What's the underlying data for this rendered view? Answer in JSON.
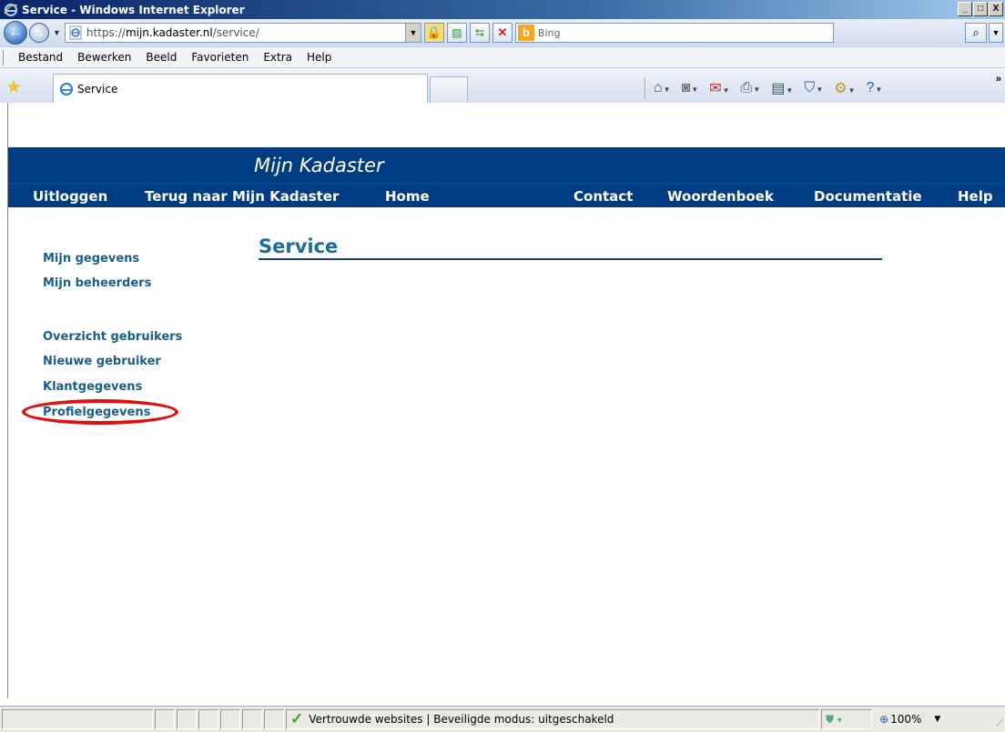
{
  "window": {
    "title": "Service - Windows Internet Explorer",
    "minimize": "_",
    "maximize": "□",
    "close": "X"
  },
  "address_bar": {
    "url_proto": "https://",
    "url_host": "mijn.kadaster.nl",
    "url_path": "/service/"
  },
  "search": {
    "placeholder": "Bing",
    "go": "⌕"
  },
  "menu": {
    "items": [
      "Bestand",
      "Bewerken",
      "Beeld",
      "Favorieten",
      "Extra",
      "Help"
    ]
  },
  "tab": {
    "label": "Service"
  },
  "site": {
    "brand": "Mijn Kadaster",
    "nav": {
      "logout": "Uitloggen",
      "back": "Terug naar Mijn Kadaster",
      "home": "Home",
      "contact": "Contact",
      "dictionary": "Woordenboek",
      "documentation": "Documentatie",
      "help": "Help"
    },
    "sidebar": {
      "my_details": "Mijn gegevens",
      "my_managers": "Mijn beheerders",
      "user_overview": "Overzicht gebruikers",
      "new_user": "Nieuwe gebruiker",
      "client_details": "Klantgegevens",
      "profile_details": "Profielgegevens"
    },
    "page_title": "Service"
  },
  "status": {
    "zone": "Vertrouwde websites | Beveiligde modus: uitgeschakeld",
    "zoom": "100%"
  },
  "colors": {
    "navy": "#003c82",
    "link": "#1a5f8c",
    "highlight": "#e01010"
  }
}
